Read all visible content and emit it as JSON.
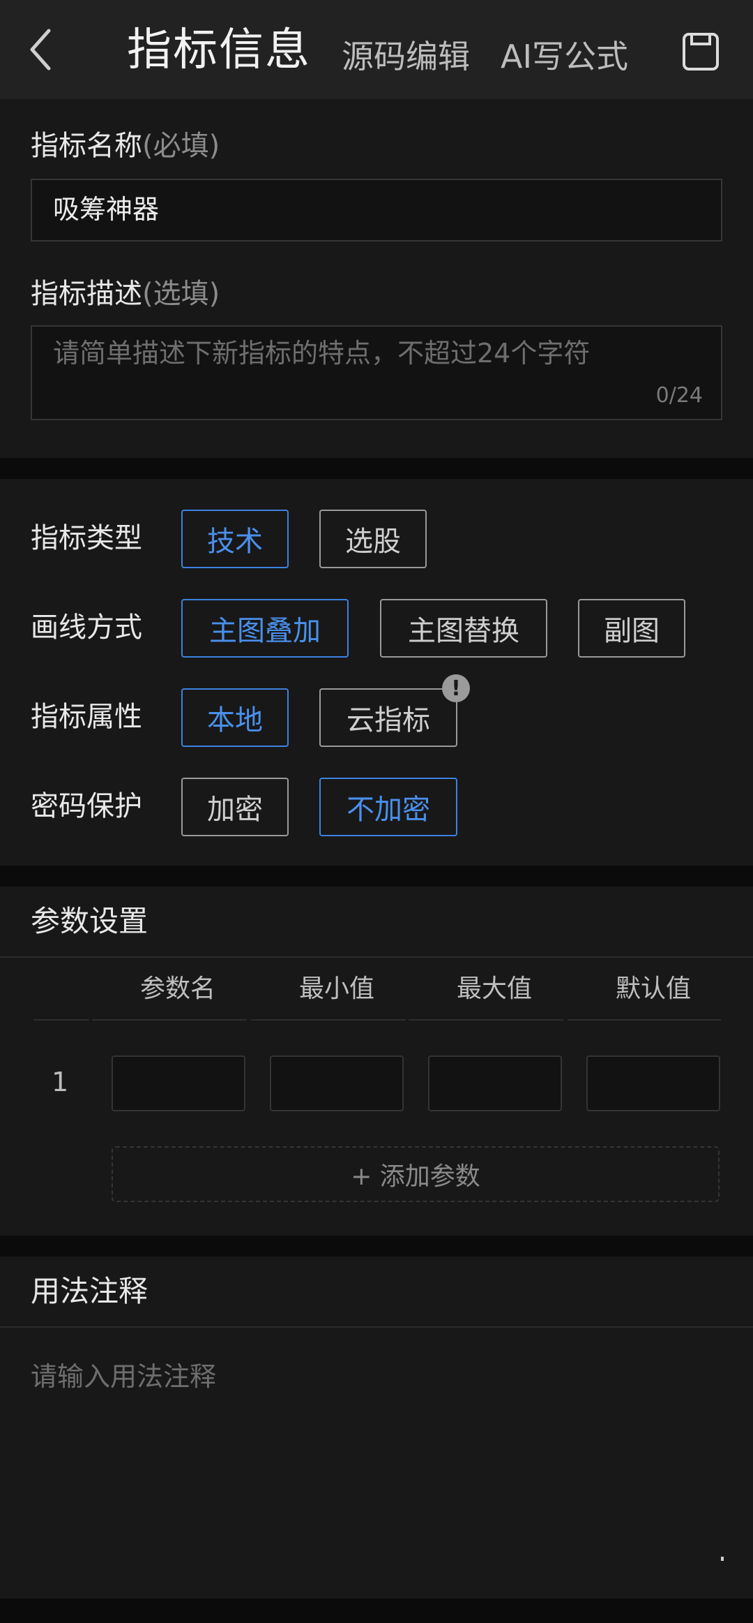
{
  "header": {
    "title": "指标信息",
    "tab_source": "源码编辑",
    "tab_ai": "AI写公式",
    "back_icon": "chevron-left-icon",
    "save_icon": "save-icon"
  },
  "basic": {
    "name_label": "指标名称",
    "name_hint": "(必填)",
    "name_value": "吸筹神器",
    "desc_label": "指标描述",
    "desc_hint": "(选填)",
    "desc_placeholder": "请简单描述下新指标的特点，不超过24个字符",
    "desc_counter": "0/24"
  },
  "options": {
    "type_label": "指标类型",
    "type_tech": "技术",
    "type_stock": "选股",
    "draw_label": "画线方式",
    "draw_overlay": "主图叠加",
    "draw_replace": "主图替换",
    "draw_sub": "副图",
    "attr_label": "指标属性",
    "attr_local": "本地",
    "attr_cloud": "云指标",
    "attr_badge": "!",
    "pwd_label": "密码保护",
    "pwd_encrypt": "加密",
    "pwd_none": "不加密"
  },
  "params": {
    "title": "参数设置",
    "columns": [
      "参数名",
      "最小值",
      "最大值",
      "默认值"
    ],
    "row_index": "1",
    "add_label": "+ 添加参数"
  },
  "notes": {
    "title": "用法注释",
    "placeholder": "请输入用法注释"
  },
  "colors": {
    "accent": "#3d82e0",
    "background": "#181818",
    "header": "#222222"
  }
}
